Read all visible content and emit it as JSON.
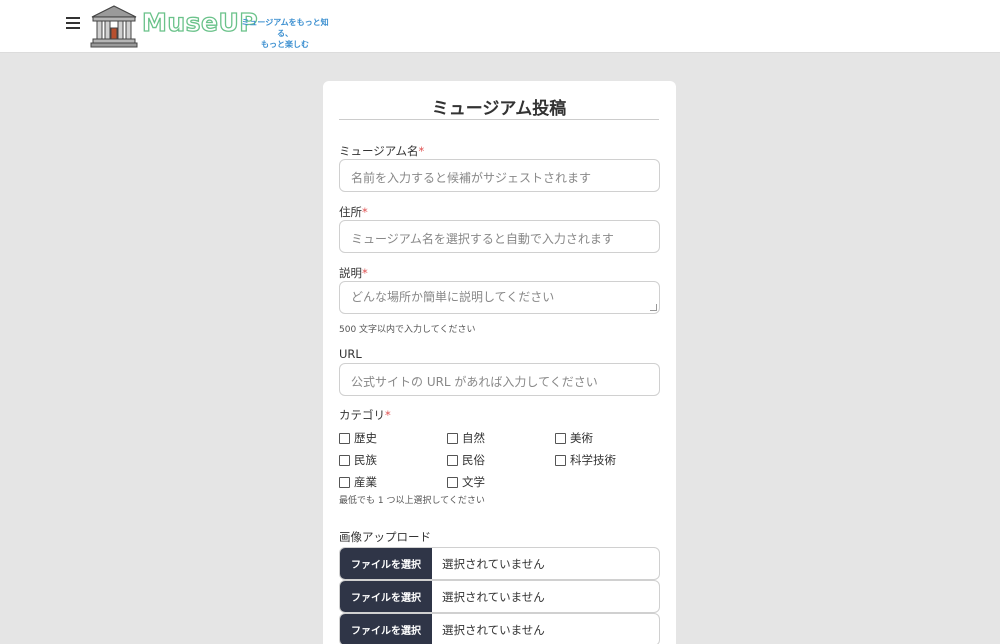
{
  "header": {
    "logo_text": "MuseUP",
    "tagline_line1": "ミュージアムをもっと知る、",
    "tagline_line2": "もっと楽しむ"
  },
  "form": {
    "title": "ミュージアム投稿",
    "name": {
      "label": "ミュージアム名",
      "required_mark": "*",
      "placeholder": "名前を入力すると候補がサジェストされます"
    },
    "address": {
      "label": "住所",
      "required_mark": "*",
      "placeholder": "ミュージアム名を選択すると自動で入力されます"
    },
    "description": {
      "label": "説明",
      "required_mark": "*",
      "placeholder": "どんな場所か簡単に説明してください",
      "note": "500 文字以内で入力してください"
    },
    "url": {
      "label": "URL",
      "placeholder": "公式サイトの URL があれば入力してください"
    },
    "category": {
      "label": "カテゴリ",
      "required_mark": "*",
      "options": [
        "歴史",
        "自然",
        "美術",
        "民族",
        "民俗",
        "科学技術",
        "産業",
        "文学"
      ],
      "note": "最低でも 1 つ以上選択してください"
    },
    "image_upload": {
      "label": "画像アップロード",
      "button_label": "ファイルを選択",
      "status_text": "選択されていません"
    }
  }
}
